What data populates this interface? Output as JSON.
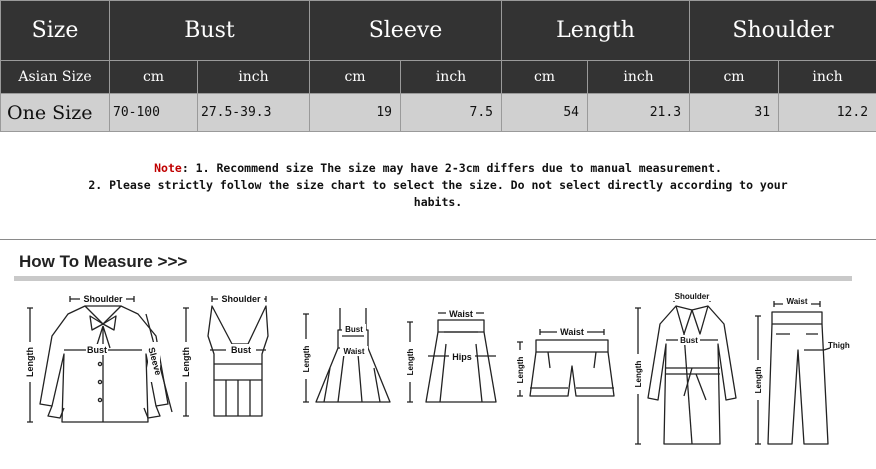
{
  "table": {
    "headers": [
      "Size",
      "Bust",
      "Sleeve",
      "Length",
      "Shoulder"
    ],
    "subheaders": [
      "Asian Size",
      "cm",
      "inch",
      "cm",
      "inch",
      "cm",
      "inch",
      "cm",
      "inch"
    ],
    "row": [
      "One Size",
      "70-100",
      "27.5-39.3",
      "19",
      "7.5",
      "54",
      "21.3",
      "31",
      "12.2"
    ]
  },
  "note": {
    "keyword": "Note",
    "line1": ": 1. Recommend size  The size may have 2-3cm differs due to manual measurement.",
    "line2": "2. Please strictly follow the size chart to select the size. Do not select directly according to your",
    "line3": "habits."
  },
  "measure": {
    "title": "How To Measure >>>",
    "labels": {
      "shoulder": "Shoulder",
      "bust": "Bust",
      "sleeve": "Sleeve",
      "length": "Length",
      "waist": "Waist",
      "hips": "Hips",
      "thigh": "Thigh"
    }
  }
}
